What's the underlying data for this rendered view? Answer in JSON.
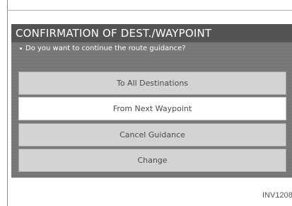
{
  "dialog": {
    "title": "CONFIRMATION OF DEST./WAYPOINT",
    "question": "Do you want to continue the route guidance?",
    "options": [
      {
        "label": "To All Destinations",
        "selected": false
      },
      {
        "label": "From Next Waypoint",
        "selected": true
      },
      {
        "label": "Cancel Guidance",
        "selected": false
      },
      {
        "label": "Change",
        "selected": false
      }
    ]
  },
  "figure_code": "INV1208"
}
